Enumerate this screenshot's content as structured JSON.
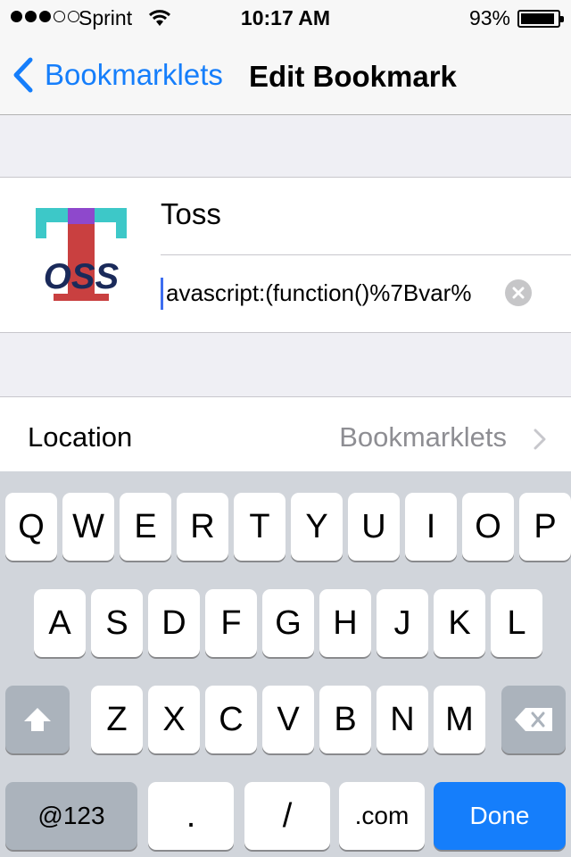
{
  "status_bar": {
    "carrier": "Sprint",
    "time": "10:17 AM",
    "battery_percent": "93%",
    "battery_level": 0.93,
    "signal_bars_filled": 3,
    "signal_bars_total": 5
  },
  "nav": {
    "back_label": "Bookmarklets",
    "title": "Edit Bookmark"
  },
  "bookmark": {
    "title": "Toss",
    "url": "avascript:(function()%7Bvar%",
    "logo_text": "OSS"
  },
  "location": {
    "label": "Location",
    "value": "Bookmarklets"
  },
  "keyboard": {
    "row1": [
      "Q",
      "W",
      "E",
      "R",
      "T",
      "Y",
      "U",
      "I",
      "O",
      "P"
    ],
    "row2": [
      "A",
      "S",
      "D",
      "F",
      "G",
      "H",
      "J",
      "K",
      "L"
    ],
    "row3": [
      "Z",
      "X",
      "C",
      "V",
      "B",
      "N",
      "M"
    ],
    "numbers_key": "@123",
    "period_key": ".",
    "slash_key": "/",
    "dotcom_key": ".com",
    "done_key": "Done"
  },
  "colors": {
    "accent": "#157efb",
    "logo_teal": "#3dc8c8",
    "logo_red": "#c94040",
    "logo_purple": "#8e48cc",
    "logo_navy": "#1a2a5a"
  }
}
